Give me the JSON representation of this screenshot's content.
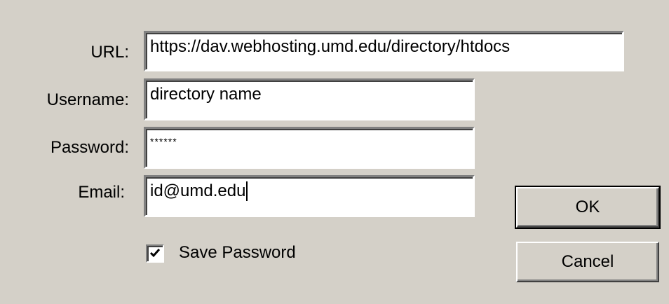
{
  "fields": {
    "url": {
      "label": "URL:",
      "value": "https://dav.webhosting.umd.edu/directory/htdocs"
    },
    "username": {
      "label": "Username:",
      "value": "directory name"
    },
    "password": {
      "label": "Password:",
      "value": "******"
    },
    "email": {
      "label": "Email:",
      "value": "id@umd.edu"
    }
  },
  "save_password": {
    "label": "Save Password",
    "checked": true
  },
  "buttons": {
    "ok": "OK",
    "cancel": "Cancel"
  },
  "colors": {
    "dialog_bg": "#d4d0c8",
    "field_bg": "#ffffff"
  }
}
